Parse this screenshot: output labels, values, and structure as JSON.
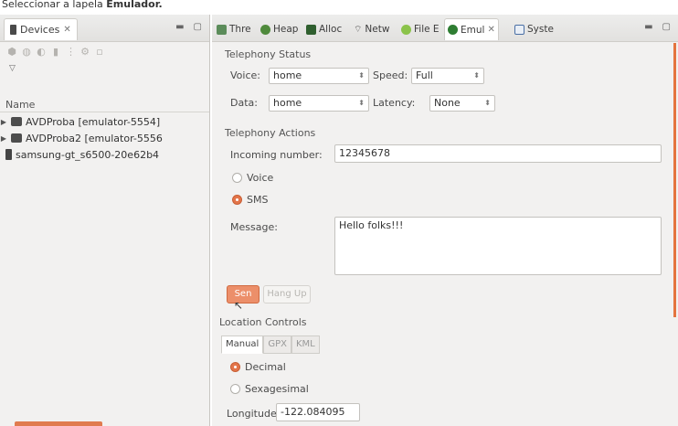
{
  "caption": {
    "prefix": "Seleccionar a lapela ",
    "bold": "Emulador."
  },
  "left_panel": {
    "tab_label": "Devices",
    "column_header": "Name",
    "devices": [
      {
        "label": "AVDProba [emulator-5554]",
        "type": "emulator",
        "expandable": true
      },
      {
        "label": "AVDProba2 [emulator-5556",
        "type": "emulator",
        "expandable": true
      },
      {
        "label": "samsung-gt_s6500-20e62b4",
        "type": "phone",
        "expandable": false
      }
    ]
  },
  "right_panel": {
    "tabs": [
      {
        "label": "Thre",
        "icon": "threads-icon",
        "color": "#5b8c5a"
      },
      {
        "label": "Heap",
        "icon": "heap-icon",
        "color": "#4f8a3c"
      },
      {
        "label": "Alloc",
        "icon": "alloc-icon",
        "color": "#2f5f2f"
      },
      {
        "label": "Netw",
        "icon": "network-icon",
        "color": "#444444"
      },
      {
        "label": "File E",
        "icon": "file-explorer-icon",
        "color": "#8bc34a"
      },
      {
        "label": "Emul",
        "icon": "emulator-icon",
        "color": "#2e7d32"
      },
      {
        "label": "Syste",
        "icon": "system-icon",
        "color": "#4a6fa5"
      }
    ],
    "telephony_status": {
      "title": "Telephony Status",
      "voice_label": "Voice:",
      "voice_value": "home",
      "speed_label": "Speed:",
      "speed_value": "Full",
      "data_label": "Data:",
      "data_value": "home",
      "latency_label": "Latency:",
      "latency_value": "None"
    },
    "telephony_actions": {
      "title": "Telephony Actions",
      "incoming_label": "Incoming number:",
      "incoming_value": "12345678",
      "voice_radio": "Voice",
      "sms_radio": "SMS",
      "selected": "sms",
      "message_label": "Message:",
      "message_value": "Hello folks!!!",
      "send_button": "Sen",
      "hangup_button": "Hang Up"
    },
    "location": {
      "title": "Location Controls",
      "tabs": [
        "Manual",
        "GPX",
        "KML"
      ],
      "active_tab": "Manual",
      "decimal": "Decimal",
      "sexagesimal": "Sexagesimal",
      "selected": "decimal",
      "longitude_label": "Longitude",
      "longitude_value": "-122.084095"
    }
  },
  "colors": {
    "accent": "#e3754a",
    "panel_bg": "#f2f1f0"
  }
}
